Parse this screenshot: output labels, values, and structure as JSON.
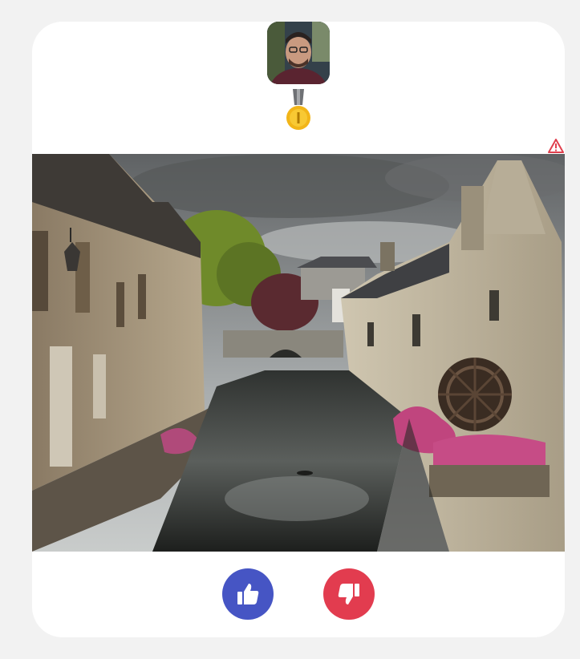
{
  "card": {
    "avatar_icon": "user-avatar-photo",
    "badge_icon": "gold-medal-icon",
    "report_icon": "warning-triangle-icon",
    "photo_subject": "canal-with-water-mill-photo"
  },
  "actions": {
    "like_icon": "thumbs-up-icon",
    "dislike_icon": "thumbs-down-icon"
  },
  "colors": {
    "like": "#4655c4",
    "dislike": "#e23c4f",
    "medal_gold": "#f2b518",
    "report": "#e0404e"
  }
}
